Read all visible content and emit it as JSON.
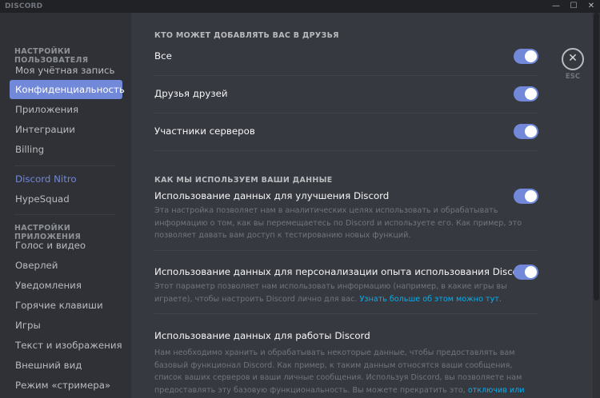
{
  "titlebar": {
    "brand": "DISCORD",
    "controls": [
      "—",
      "☐",
      "✕"
    ]
  },
  "sidebar": {
    "user_settings_header": "НАСТРОЙКИ ПОЛЬЗОВАТЕЛЯ",
    "user_items": [
      "Моя учётная запись",
      "Конфиденциальность",
      "Приложения",
      "Интеграции",
      "Billing"
    ],
    "active_item": "Конфиденциальность",
    "nitro_items": [
      "Discord Nitro",
      "HypeSquad"
    ],
    "app_settings_header": "НАСТРОЙКИ ПРИЛОЖЕНИЯ",
    "app_items": [
      "Голос и видео",
      "Оверлей",
      "Уведомления",
      "Горячие клавиши",
      "Игры",
      "Текст и изображения",
      "Внешний вид",
      "Режим «стримера»"
    ]
  },
  "friend_requests": {
    "header": "КТО МОЖЕТ ДОБАВЛЯТЬ ВАС В ДРУЗЬЯ",
    "rows": [
      {
        "label": "Все",
        "enabled": true
      },
      {
        "label": "Друзья друзей",
        "enabled": true
      },
      {
        "label": "Участники серверов",
        "enabled": true
      }
    ]
  },
  "data_usage": {
    "header": "КАК МЫ ИСПОЛЬЗУЕМ ВАШИ ДАННЫЕ",
    "improve": {
      "label": "Использование данных для улучшения Discord",
      "enabled": true,
      "description": "Эта настройка позволяет нам в аналитических целях использовать и обрабатывать информацию о том, как вы перемещаетесь по Discord и используете его. Как пример, это позволяет давать вам доступ к тестированию новых функций."
    },
    "personalize": {
      "label": "Использование данных для персонализации опыта использования Discord",
      "enabled": true,
      "description": "Этот параметр позволяет нам использовать информацию (например, в какие игры вы играете), чтобы настроить Discord лично для вас.",
      "link": "Узнать больше об этом можно тут."
    },
    "operate": {
      "label": "Использование данных для работы Discord",
      "description": "Нам необходимо хранить и обрабатывать некоторые данные, чтобы предоставлять вам базовый функционал Discord. Как пример, к таким данным относятся ваши сообщения, список ваших серверов и ваши личные сообщения. Используя Discord, вы позволяете нам предоставлять эту базовую функциональность. Вы можете прекратить это,",
      "link": "отключив или удалив вашу учётную запись."
    }
  },
  "close": {
    "icon": "close-icon",
    "label": "ESC"
  },
  "colors": {
    "accent": "#7289da",
    "link": "#00b0f4",
    "sidebar_bg": "#2f3136",
    "main_bg": "#36393f"
  }
}
